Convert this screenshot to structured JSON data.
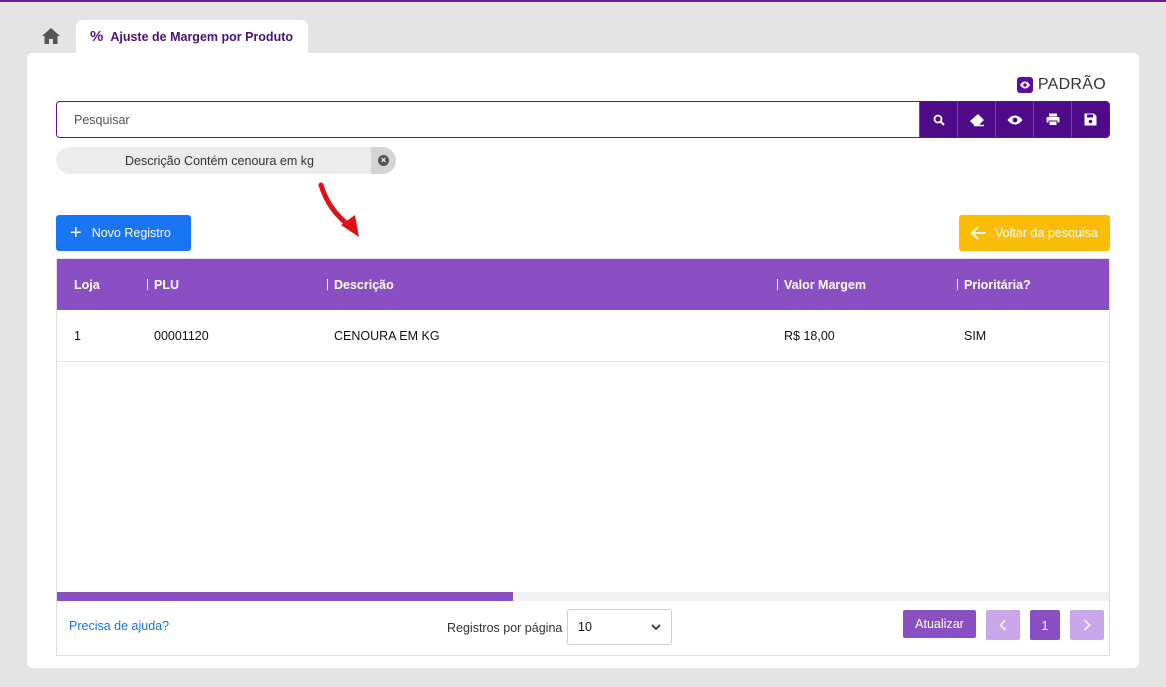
{
  "tabs": {
    "home_icon": "home-icon",
    "active_icon": "%",
    "active_label": "Ajuste de Margem por Produto"
  },
  "view_preset": {
    "icon": "eye-icon",
    "label": "PADRÃO"
  },
  "search": {
    "placeholder": "Pesquisar",
    "value": "",
    "buttons": [
      "search-icon",
      "eraser-icon",
      "eye-icon",
      "print-icon",
      "save-icon"
    ]
  },
  "filter_chip": {
    "text": "Descrição Contém cenoura em kg"
  },
  "actions": {
    "new_label": "Novo Registro",
    "back_label": "Voltar da pesquisa"
  },
  "table": {
    "columns": [
      "Loja",
      "PLU",
      "Descrição",
      "Valor Margem",
      "Prioritária?"
    ],
    "rows": [
      [
        "1",
        "00001120",
        "CENOURA EM KG",
        "R$ 18,00",
        "SIM"
      ]
    ]
  },
  "footer": {
    "help_label": "Precisa de ajuda?",
    "rows_per_page_label": "Registros por página",
    "rows_per_page_value": "10",
    "refresh_label": "Atualizar",
    "prev_label": "‹",
    "current_page": "1",
    "next_label": "›"
  },
  "colors": {
    "primary_dark": "#4d0b8a",
    "primary": "#8a4fc2",
    "primary_light": "#c9a7ea",
    "blue": "#1976f3",
    "yellow": "#fcbd06",
    "annotation_arrow": "#e0101a"
  }
}
